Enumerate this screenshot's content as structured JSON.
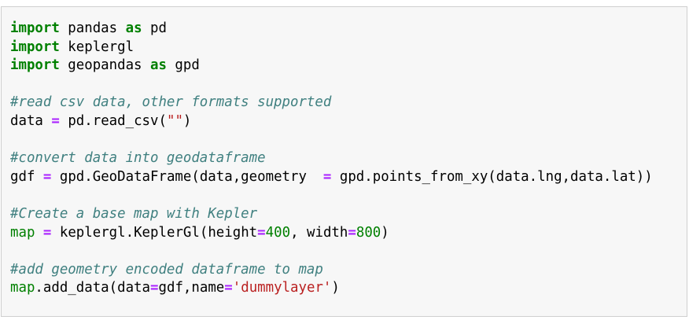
{
  "cell": {
    "lines": [
      [
        {
          "t": "import",
          "k": "kw"
        },
        {
          "t": " pandas ",
          "k": "tx"
        },
        {
          "t": "as",
          "k": "kw"
        },
        {
          "t": " pd",
          "k": "tx"
        }
      ],
      [
        {
          "t": "import",
          "k": "kw"
        },
        {
          "t": " keplergl",
          "k": "tx"
        }
      ],
      [
        {
          "t": "import",
          "k": "kw"
        },
        {
          "t": " geopandas ",
          "k": "tx"
        },
        {
          "t": "as",
          "k": "kw"
        },
        {
          "t": " gpd",
          "k": "tx"
        }
      ],
      [],
      [
        {
          "t": "#read csv data, other formats supported",
          "k": "cm"
        }
      ],
      [
        {
          "t": "data ",
          "k": "tx"
        },
        {
          "t": "=",
          "k": "op"
        },
        {
          "t": " pd.read_csv(",
          "k": "tx"
        },
        {
          "t": "\"\"",
          "k": "str"
        },
        {
          "t": ")",
          "k": "tx"
        }
      ],
      [],
      [
        {
          "t": "#convert data into geodataframe",
          "k": "cm"
        }
      ],
      [
        {
          "t": "gdf ",
          "k": "tx"
        },
        {
          "t": "=",
          "k": "op"
        },
        {
          "t": " gpd.GeoDataFrame(data,geometry  ",
          "k": "tx"
        },
        {
          "t": "=",
          "k": "op"
        },
        {
          "t": " gpd.points_from_xy(data.lng,data.lat))",
          "k": "tx"
        }
      ],
      [],
      [
        {
          "t": "#Create a base map with Kepler",
          "k": "cm"
        }
      ],
      [
        {
          "t": "map",
          "k": "nm"
        },
        {
          "t": " ",
          "k": "tx"
        },
        {
          "t": "=",
          "k": "op"
        },
        {
          "t": " keplergl.KeplerGl(height",
          "k": "tx"
        },
        {
          "t": "=",
          "k": "op"
        },
        {
          "t": "400",
          "k": "num"
        },
        {
          "t": ", width",
          "k": "tx"
        },
        {
          "t": "=",
          "k": "op"
        },
        {
          "t": "800",
          "k": "num"
        },
        {
          "t": ")",
          "k": "tx"
        }
      ],
      [],
      [
        {
          "t": "#add geometry encoded dataframe to map",
          "k": "cm"
        }
      ],
      [
        {
          "t": "map",
          "k": "nm"
        },
        {
          "t": ".add_data(data",
          "k": "tx"
        },
        {
          "t": "=",
          "k": "op"
        },
        {
          "t": "gdf,name",
          "k": "tx"
        },
        {
          "t": "=",
          "k": "op"
        },
        {
          "t": "'dummylayer'",
          "k": "str"
        },
        {
          "t": ")",
          "k": "tx"
        }
      ]
    ]
  },
  "colors": {
    "keyword": "#008000",
    "operator": "#aa22ff",
    "comment": "#408080",
    "string": "#ba2121",
    "number": "#008000",
    "cell_background": "#f7f7f7",
    "cell_border": "#cfcfcf"
  }
}
